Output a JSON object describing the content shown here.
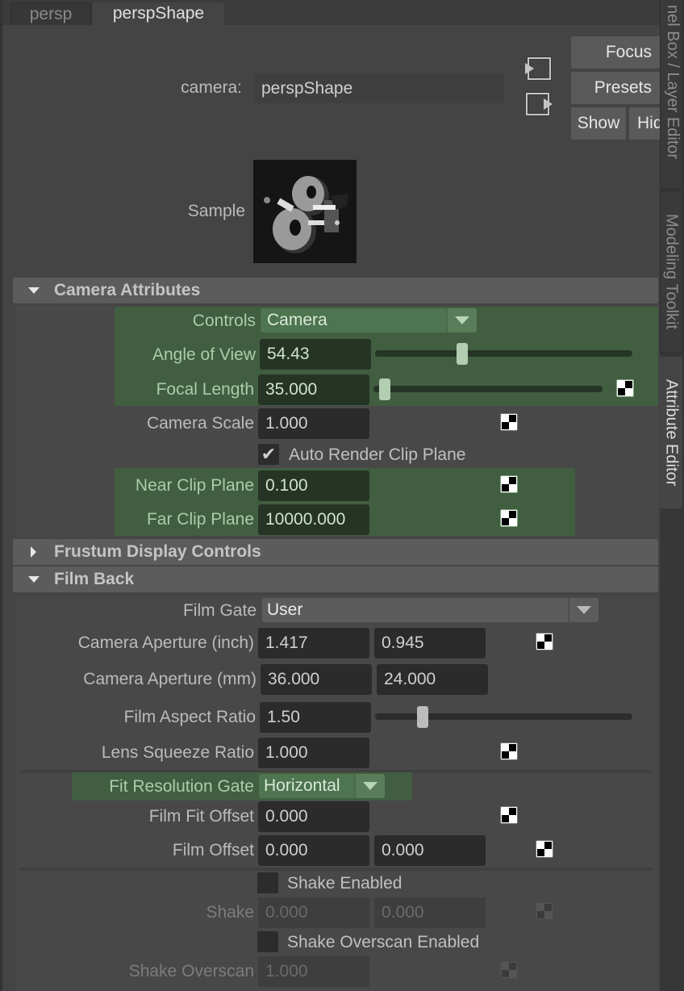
{
  "tabs": [
    {
      "label": "persp",
      "active": false
    },
    {
      "label": "perspShape",
      "active": true
    }
  ],
  "header": {
    "camera_label": "camera:",
    "camera_value": "perspShape",
    "focus_label": "Focus",
    "presets_label": "Presets",
    "show_label": "Show",
    "hide_label": "Hide",
    "sample_label": "Sample"
  },
  "dock_tabs": [
    {
      "label": "Channel Box / Layer Editor",
      "visible_text": "nel Box / Layer Editor",
      "active": false
    },
    {
      "label": "Modeling Toolkit",
      "active": false
    },
    {
      "label": "Attribute Editor",
      "active": true
    }
  ],
  "sections": {
    "camera_attributes": {
      "title": "Camera Attributes",
      "expanded": true,
      "controls": {
        "label": "Controls",
        "value": "Camera"
      },
      "angle_of_view": {
        "label": "Angle of View",
        "value": "54.43",
        "slider_fraction": 0.33
      },
      "focal_length": {
        "label": "Focal Length",
        "value": "35.000",
        "slider_fraction": 0.02
      },
      "camera_scale": {
        "label": "Camera Scale",
        "value": "1.000"
      },
      "auto_render_clip": {
        "label": "Auto Render Clip Plane",
        "checked": true,
        "check_glyph": "✔"
      },
      "near_clip": {
        "label": "Near Clip Plane",
        "value": "0.100"
      },
      "far_clip": {
        "label": "Far Clip Plane",
        "value": "10000.000"
      }
    },
    "frustum": {
      "title": "Frustum Display Controls",
      "expanded": false
    },
    "film_back": {
      "title": "Film Back",
      "expanded": true,
      "film_gate": {
        "label": "Film Gate",
        "value": "User"
      },
      "aperture_inch": {
        "label": "Camera Aperture (inch)",
        "value_x": "1.417",
        "value_y": "0.945"
      },
      "aperture_mm": {
        "label": "Camera Aperture (mm)",
        "value_x": "36.000",
        "value_y": "24.000"
      },
      "film_aspect": {
        "label": "Film Aspect Ratio",
        "value": "1.50",
        "slider_fraction": 0.17
      },
      "lens_squeeze": {
        "label": "Lens Squeeze Ratio",
        "value": "1.000"
      },
      "fit_resolution_gate": {
        "label": "Fit Resolution Gate",
        "value": "Horizontal"
      },
      "film_fit_offset": {
        "label": "Film Fit Offset",
        "value": "0.000"
      },
      "film_offset": {
        "label": "Film Offset",
        "value_x": "0.000",
        "value_y": "0.000"
      },
      "shake_enabled": {
        "label": "Shake Enabled",
        "checked": false
      },
      "shake": {
        "label": "Shake",
        "value_x": "0.000",
        "value_y": "0.000",
        "disabled": true
      },
      "shake_overscan_enabled": {
        "label": "Shake Overscan Enabled",
        "checked": false
      },
      "shake_overscan": {
        "label": "Shake Overscan",
        "value": "1.000",
        "disabled": true
      }
    }
  },
  "colors": {
    "background": "#444444",
    "section_header": "#5c5c5c",
    "keyed_green": "#415e41",
    "field_dark": "#2b2b2b"
  }
}
